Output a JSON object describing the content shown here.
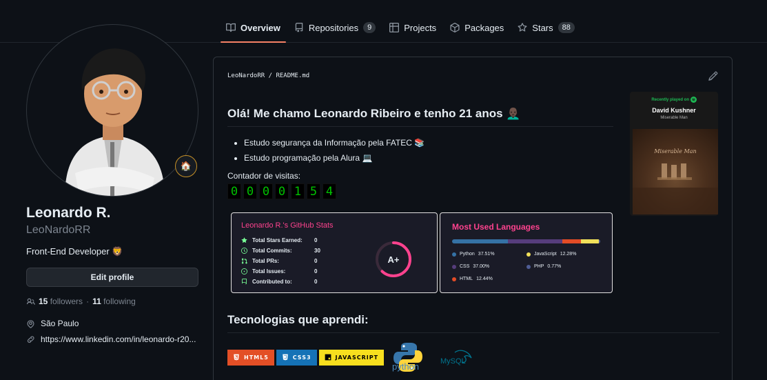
{
  "nav": {
    "tabs": [
      {
        "label": "Overview",
        "icon": "book-icon",
        "count": ""
      },
      {
        "label": "Repositories",
        "icon": "repo-icon",
        "count": "9"
      },
      {
        "label": "Projects",
        "icon": "table-icon",
        "count": ""
      },
      {
        "label": "Packages",
        "icon": "package-icon",
        "count": ""
      },
      {
        "label": "Stars",
        "icon": "star-icon",
        "count": "88"
      }
    ]
  },
  "profile": {
    "name": "Leonardo R.",
    "login": "LeoNardoRR",
    "bio": "Front-End Developer 🦁",
    "status_emoji": "🏠",
    "edit_label": "Edit profile",
    "followers_count": "15",
    "followers_label": "followers",
    "separator": "·",
    "following_count": "11",
    "following_label": "following",
    "location": "São Paulo",
    "website": "https://www.linkedin.com/in/leonardo-r20..."
  },
  "readme": {
    "crumb_user": "LeoNardoRR",
    "crumb_sep": " / ",
    "crumb_file": "README.md",
    "heading": "Olá! Me chamo Leonardo Ribeiro e tenho 21 anos 👨🏿‍🦲",
    "bullets": [
      "Estudo segurança da Informação pela FATEC 📚",
      "Estudo programação pela Alura 💻"
    ],
    "visits_label": "Contador de visitas:",
    "visits_digits": [
      "0",
      "0",
      "0",
      "0",
      "1",
      "5",
      "4"
    ],
    "tech_heading": "Tecnologias que aprendi:"
  },
  "stats": {
    "title": "Leonardo R.'s GitHub Stats",
    "rows": [
      {
        "label": "Total Stars Earned:",
        "value": "0",
        "icon": "star-icon"
      },
      {
        "label": "Total Commits:",
        "value": "30",
        "icon": "clock-icon"
      },
      {
        "label": "Total PRs:",
        "value": "0",
        "icon": "pull-request-icon"
      },
      {
        "label": "Total Issues:",
        "value": "0",
        "icon": "issue-icon"
      },
      {
        "label": "Contributed to:",
        "value": "0",
        "icon": "repo-icon"
      }
    ],
    "grade": "A+",
    "grade_fill": 0.62
  },
  "languages": {
    "title": "Most Used Languages",
    "items": [
      {
        "name": "Python",
        "pct": "37.51%",
        "value": 37.51,
        "color": "#3572A5"
      },
      {
        "name": "JavaScript",
        "pct": "12.28%",
        "value": 12.28,
        "color": "#f1e05a"
      },
      {
        "name": "CSS",
        "pct": "37.00%",
        "value": 37.0,
        "color": "#563d7c"
      },
      {
        "name": "PHP",
        "pct": "0.77%",
        "value": 0.77,
        "color": "#4F5D95"
      },
      {
        "name": "HTML",
        "pct": "12.44%",
        "value": 12.44,
        "color": "#e34c26"
      }
    ]
  },
  "spotify": {
    "label": "Recently played on",
    "artist": "David Kushner",
    "song": "Miserable Man",
    "cover_text": "Miserable Man"
  },
  "badges": [
    {
      "label": "HTML5",
      "icon": "html5-icon"
    },
    {
      "label": "CSS3",
      "icon": "css3-icon"
    },
    {
      "label": "JAVASCRIPT",
      "icon": "javascript-icon"
    }
  ],
  "logos": {
    "python": "python",
    "mysql": "MySQL"
  },
  "colors": {
    "accent_tab": "#f78166",
    "stats_title": "#fe428e",
    "spotify_green": "#1db954"
  }
}
